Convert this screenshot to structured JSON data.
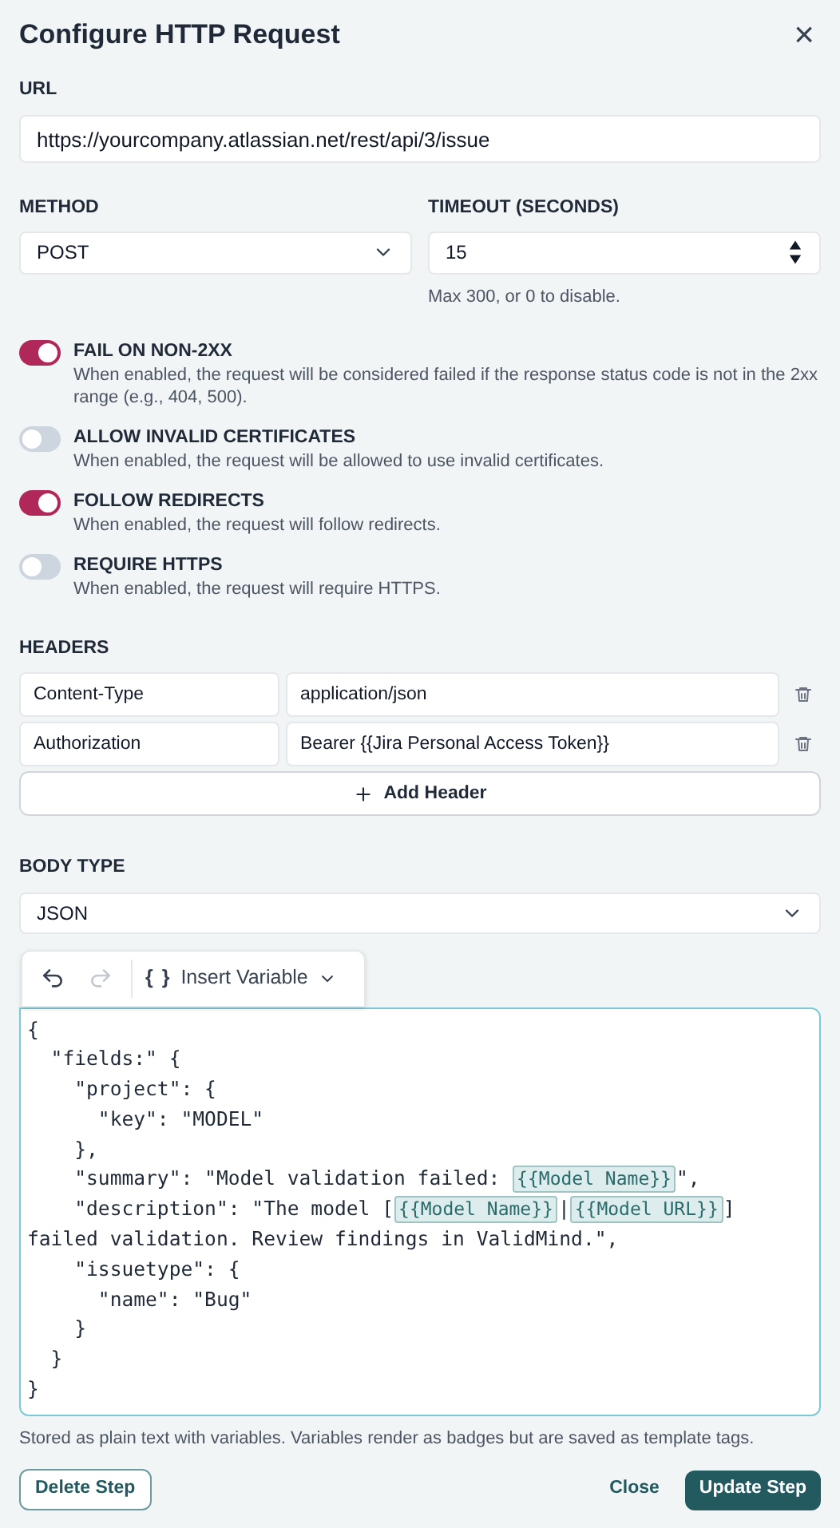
{
  "window": {
    "title": "Configure HTTP Request",
    "close": "×"
  },
  "url": {
    "label": "URL",
    "value": "https://yourcompany.atlassian.net/rest/api/3/issue"
  },
  "method": {
    "label": "METHOD",
    "value": "POST"
  },
  "timeout": {
    "label": "TIMEOUT (SECONDS)",
    "value": "15",
    "hint": "Max 300, or 0 to disable."
  },
  "toggles": [
    {
      "label": "FAIL ON NON-2XX",
      "description": "When enabled, the request will be considered failed if the response status code is not in the 2xx range (e.g., 404, 500).",
      "on": true
    },
    {
      "label": "ALLOW INVALID CERTIFICATES",
      "description": "When enabled, the request will be allowed to use invalid certificates.",
      "on": false
    },
    {
      "label": "FOLLOW REDIRECTS",
      "description": "When enabled, the request will follow redirects.",
      "on": true
    },
    {
      "label": "REQUIRE HTTPS",
      "description": "When enabled, the request will require HTTPS.",
      "on": false
    }
  ],
  "headers": {
    "label": "HEADERS",
    "rows": [
      {
        "name": "Content-Type",
        "value": "application/json"
      },
      {
        "name": "Authorization",
        "value": "Bearer {{Jira Personal Access Token}}"
      }
    ],
    "add_button": "Add Header"
  },
  "body_type": {
    "label": "BODY TYPE",
    "value": "JSON"
  },
  "editor": {
    "toolbar": {
      "undo_enabled": true,
      "redo_enabled": false,
      "insert_variable": "Insert Variable",
      "insert_icon": "{ }"
    },
    "lines": [
      [
        {
          "kind": "text",
          "text": "{"
        }
      ],
      [
        {
          "kind": "text",
          "text": "  \"fields:\" {"
        }
      ],
      [
        {
          "kind": "text",
          "text": "    \"project\": {"
        }
      ],
      [
        {
          "kind": "text",
          "text": "      \"key\": \"MODEL\""
        }
      ],
      [
        {
          "kind": "text",
          "text": "    },"
        }
      ],
      [
        {
          "kind": "text",
          "text": "    \"summary\": \"Model validation failed: "
        },
        {
          "kind": "variable",
          "text": "{{Model Name}}"
        },
        {
          "kind": "text",
          "text": "\","
        }
      ],
      [
        {
          "kind": "text",
          "text": "    \"description\": \"The model ["
        },
        {
          "kind": "variable",
          "text": "{{Model Name}}"
        },
        {
          "kind": "text",
          "text": "|"
        },
        {
          "kind": "variable",
          "text": "{{Model URL}}"
        },
        {
          "kind": "text",
          "text": "]"
        }
      ],
      [
        {
          "kind": "text",
          "text": "failed validation. Review findings in ValidMind.\","
        }
      ],
      [
        {
          "kind": "text",
          "text": "    \"issuetype\": {"
        }
      ],
      [
        {
          "kind": "text",
          "text": "      \"name\": \"Bug\""
        }
      ],
      [
        {
          "kind": "text",
          "text": "    }"
        }
      ],
      [
        {
          "kind": "text",
          "text": "  }"
        }
      ],
      [
        {
          "kind": "text",
          "text": "}"
        }
      ]
    ],
    "hint": "Stored as plain text with variables. Variables render as badges but are saved as template tags."
  },
  "footer": {
    "delete": "Delete Step",
    "close": "Close",
    "update": "Update Step"
  }
}
